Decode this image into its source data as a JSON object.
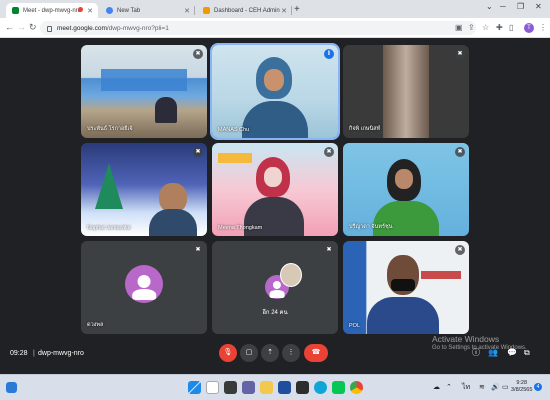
{
  "browser": {
    "tabs": [
      {
        "label": "Meet - dwp-mwvg-nro",
        "icon": "meet-icon"
      },
      {
        "label": "New Tab",
        "icon": "chrome-icon"
      },
      {
        "label": "Dashboard - CEH Admin",
        "icon": "dashboard-icon"
      }
    ],
    "new_tab": "+",
    "address": {
      "host": "meet.google.com",
      "path": "/dwp-mwvg-nro?pli=1"
    },
    "profile_initial": "T"
  },
  "meet": {
    "participants": [
      {
        "name": "ประพันธ์ โรกาอยีเจ้",
        "speaking": false,
        "camera": true
      },
      {
        "name": "MANAS Chu",
        "speaking": true,
        "camera": true
      },
      {
        "name": "กิจพิ เกษนิสท์",
        "speaking": false,
        "camera": true
      },
      {
        "name": "Naphat Jantawilai",
        "speaking": false,
        "camera": true
      },
      {
        "name": "Meena Thongkam",
        "speaking": false,
        "camera": true
      },
      {
        "name": "ปรีญาดา จันทร์ชุน",
        "speaking": false,
        "camera": true
      },
      {
        "name": "ดวงพล",
        "speaking": false,
        "camera": false
      },
      {
        "name": "อีก 24 คน",
        "speaking": false,
        "camera": false
      },
      {
        "name": "POL",
        "speaking": false,
        "camera": true
      }
    ],
    "time": "09:28",
    "separator": "|",
    "meeting_code": "dwp-mwvg-nro"
  },
  "watermark": {
    "line1": "Activate Windows",
    "line2": "Go to Settings to activate Windows."
  },
  "taskbar": {
    "clock_time": "9:28",
    "clock_date": "3/8/2565",
    "notifications": "4"
  },
  "colors": {
    "end_call": "#ea4335",
    "speaking": "#1a73e8",
    "avatar": "#b868c9"
  }
}
